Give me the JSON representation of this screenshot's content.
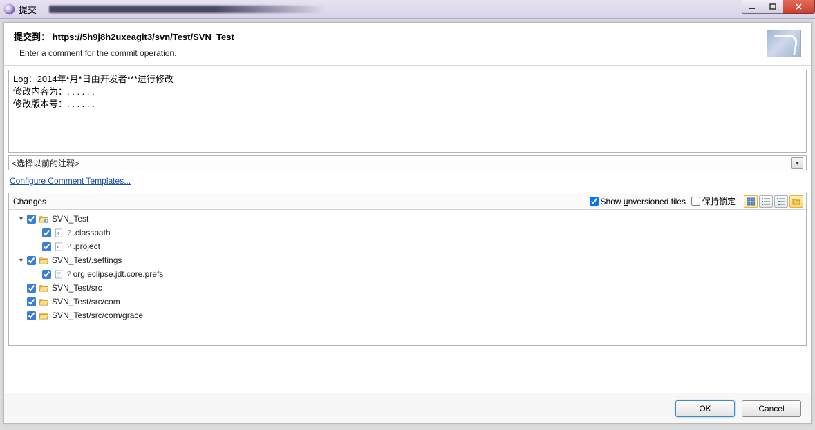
{
  "window": {
    "title": "提交"
  },
  "header": {
    "title_prefix": "提交到：",
    "url": "https://5h9j8h2uxeagit3/svn/Test/SVN_Test",
    "subtitle": "Enter a comment for the commit operation."
  },
  "comment": {
    "text": "Log：2014年*月*日由开发者***进行修改\n修改内容为：. . . . . .\n修改版本号：. . . . . ."
  },
  "prev_comment": {
    "placeholder": "<选择以前的注释>"
  },
  "links": {
    "configure": "Configure Comment Templates..."
  },
  "changes": {
    "label": "Changes",
    "show_unversioned_label_pre": "Show ",
    "show_unversioned_label_u": "u",
    "show_unversioned_label_post": "nversioned files",
    "show_unversioned_checked": true,
    "keep_lock_label": "保持锁定",
    "keep_lock_checked": false,
    "tree": [
      {
        "indent": 1,
        "expander": "open",
        "checked": true,
        "icon": "folder-shared",
        "status": "",
        "label": "SVN_Test"
      },
      {
        "indent": 2,
        "expander": "none",
        "checked": true,
        "icon": "xmlfile",
        "status": "?",
        "label": ".classpath"
      },
      {
        "indent": 2,
        "expander": "none",
        "checked": true,
        "icon": "xmlfile",
        "status": "?",
        "label": ".project"
      },
      {
        "indent": 1,
        "expander": "open",
        "checked": true,
        "icon": "folder-open",
        "status": "",
        "label": "SVN_Test/.settings"
      },
      {
        "indent": 2,
        "expander": "none",
        "checked": true,
        "icon": "file",
        "status": "?",
        "label": "org.eclipse.jdt.core.prefs"
      },
      {
        "indent": 1,
        "expander": "none",
        "checked": true,
        "icon": "folder-open",
        "status": "",
        "label": "SVN_Test/src"
      },
      {
        "indent": 1,
        "expander": "none",
        "checked": true,
        "icon": "folder-open",
        "status": "",
        "label": "SVN_Test/src/com"
      },
      {
        "indent": 1,
        "expander": "none",
        "checked": true,
        "icon": "folder-open",
        "status": "",
        "label": "SVN_Test/src/com/grace"
      }
    ]
  },
  "footer": {
    "ok": "OK",
    "cancel": "Cancel"
  }
}
